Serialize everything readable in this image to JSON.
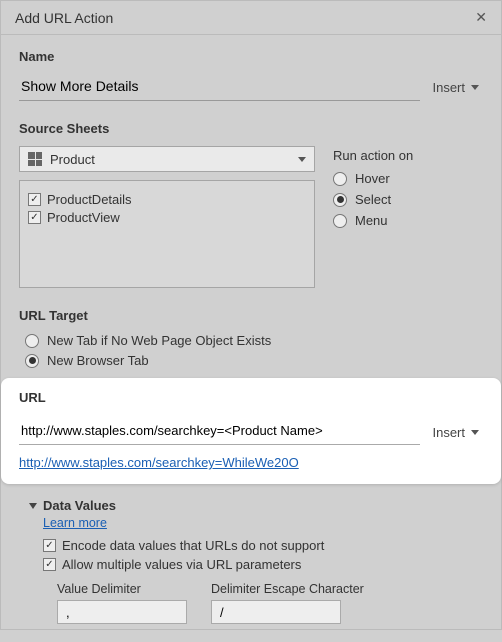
{
  "dialog": {
    "title": "Add URL Action",
    "close_glyph": "✕"
  },
  "name": {
    "label": "Name",
    "value": "Show More Details",
    "insert_label": "Insert"
  },
  "sourceSheets": {
    "label": "Source Sheets",
    "dropdown_value": "Product",
    "items": [
      {
        "label": "ProductDetails",
        "checked": true
      },
      {
        "label": "ProductView",
        "checked": true
      }
    ]
  },
  "runAction": {
    "label": "Run action on",
    "options": [
      {
        "label": "Hover",
        "selected": false
      },
      {
        "label": "Select",
        "selected": true
      },
      {
        "label": "Menu",
        "selected": false
      }
    ]
  },
  "urlTarget": {
    "label": "URL Target",
    "options": [
      {
        "label": "New Tab if No Web Page Object Exists",
        "selected": false
      },
      {
        "label": "New Browser Tab",
        "selected": true
      }
    ]
  },
  "url": {
    "label": "URL",
    "value": "http://www.staples.com/searchkey=<Product Name>",
    "insert_label": "Insert",
    "preview": "http://www.staples.com/searchkey=WhileWe20O"
  },
  "dataValues": {
    "label": "Data Values",
    "learn_more": "Learn more",
    "options": [
      {
        "label": "Encode data values that URLs do not support",
        "checked": true
      },
      {
        "label": "Allow multiple values via URL parameters",
        "checked": true
      }
    ],
    "valueDelimiter": {
      "label": "Value Delimiter",
      "value": ","
    },
    "escapeChar": {
      "label": "Delimiter Escape Character",
      "value": "/"
    }
  }
}
